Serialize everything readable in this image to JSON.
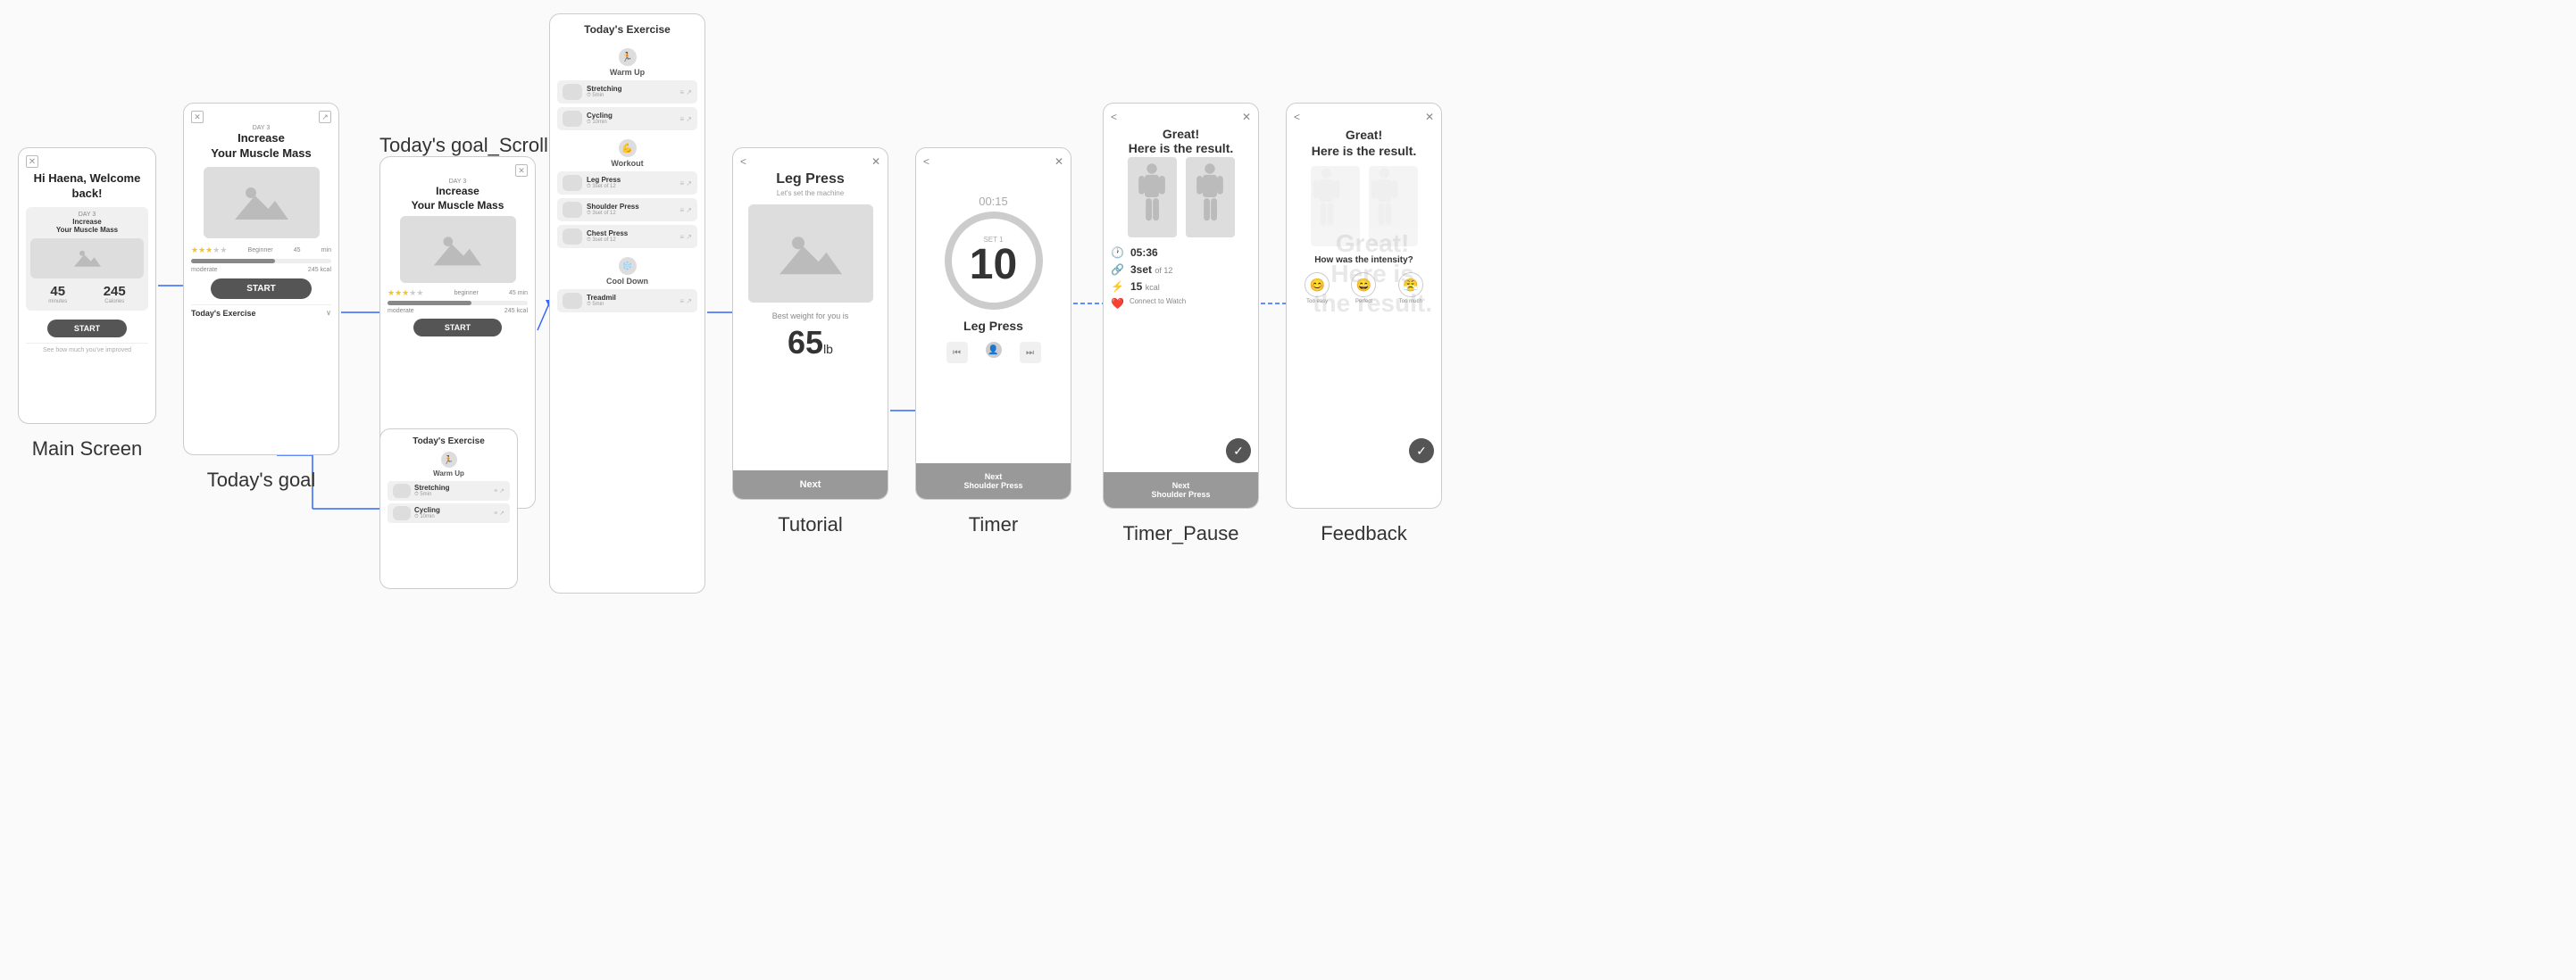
{
  "screens": {
    "main_screen": {
      "label": "Main Screen",
      "greeting": "Hi Haena,\nWelcome back!",
      "card": {
        "day": "DAY 3",
        "title": "Increase\nYour Muscle Mass"
      },
      "stats": [
        {
          "value": "45",
          "unit": "minutes"
        },
        {
          "value": "245",
          "unit": "Calories"
        }
      ],
      "start_btn": "START",
      "see_more": "See how much you've improved"
    },
    "todays_goal": {
      "label": "Today's goal",
      "day": "DAY 3",
      "title": "Increase\nYour Muscle Mass",
      "rating": {
        "filled": 3,
        "total": 5,
        "level": "Beginner"
      },
      "duration": "45",
      "duration_unit": "min",
      "calories": "245",
      "calories_unit": "kcal",
      "intensity": "moderate",
      "start_btn": "START",
      "exercise_section": "Today's Exercise"
    },
    "scroll_view": {
      "label": "Today's goal_Scroll view",
      "day": "DAY 3",
      "title": "Increase\nYour Muscle Mass",
      "rating": {
        "filled": 3,
        "total": 5,
        "level": "beginner"
      },
      "duration": "45",
      "duration_unit": "min",
      "calories": "245",
      "calories_unit": "kcal",
      "intensity": "moderate",
      "start_btn": "START"
    },
    "exercise_list": {
      "title": "Today's Exercise",
      "sections": [
        {
          "name": "Warm Up",
          "icon": "🏃",
          "exercises": [
            {
              "name": "Stretching",
              "detail": "5min",
              "icons": "≡ ↗"
            },
            {
              "name": "Cycling",
              "detail": "10min",
              "icons": "≡ ↗"
            }
          ]
        },
        {
          "name": "Workout",
          "icon": "💪",
          "exercises": [
            {
              "name": "Leg Press",
              "detail": "3set of 12",
              "icons": "≡ ↗"
            },
            {
              "name": "Shoulder Press",
              "detail": "3set of 12",
              "icons": "≡ ↗"
            },
            {
              "name": "Chest Press",
              "detail": "3set of 12",
              "icons": "≡ ↗"
            }
          ]
        },
        {
          "name": "Cool Down",
          "icon": "❄️",
          "exercises": [
            {
              "name": "Treadmil",
              "detail": "5min",
              "icons": "≡ ↗"
            }
          ]
        }
      ]
    },
    "scroll_preview": {
      "title": "Today's Exercise",
      "section_name": "Warm Up",
      "section_icon": "🏃",
      "exercises": [
        {
          "name": "Stretching",
          "detail": "5min",
          "icons": "≡ ↗"
        },
        {
          "name": "Cycling",
          "detail": "10min",
          "icons": "≡ ↗"
        }
      ]
    },
    "tutorial": {
      "label": "Tutorial",
      "exercise_name": "Leg Press",
      "subtitle": "Let's set the machine",
      "recommended_text": "Best weight for you is",
      "weight": "65",
      "weight_unit": "lb",
      "next_btn": "Next"
    },
    "timer": {
      "label": "Timer",
      "countdown": "00:15",
      "set_label": "SET 1",
      "count": "10",
      "exercise_name": "Leg Press",
      "next_btn": "Next\nShoulder Press"
    },
    "timer_pause": {
      "label": "Timer_Pause",
      "back": "<",
      "close": "✕",
      "title": "Great!\nHere is the result.",
      "stats": [
        {
          "icon": "🕐",
          "value": "05:36",
          "unit": ""
        },
        {
          "icon": "🔗",
          "value": "3set",
          "unit": "of 12"
        },
        {
          "icon": "⚡",
          "value": "15",
          "unit": "kcal"
        },
        {
          "icon": "❤️",
          "value": "Connect to Watch",
          "unit": ""
        }
      ],
      "next_btn": "Next\nShoulder Press"
    },
    "feedback": {
      "label": "Feedback",
      "back": "<",
      "close": "✕",
      "title": "Great!\nHere is the result.",
      "question": "How was the intensity?",
      "emojis": [
        {
          "symbol": "😊",
          "label": "Too easy"
        },
        {
          "symbol": "😄",
          "label": "Perfect"
        },
        {
          "symbol": "😤",
          "label": "Too much"
        }
      ]
    }
  }
}
